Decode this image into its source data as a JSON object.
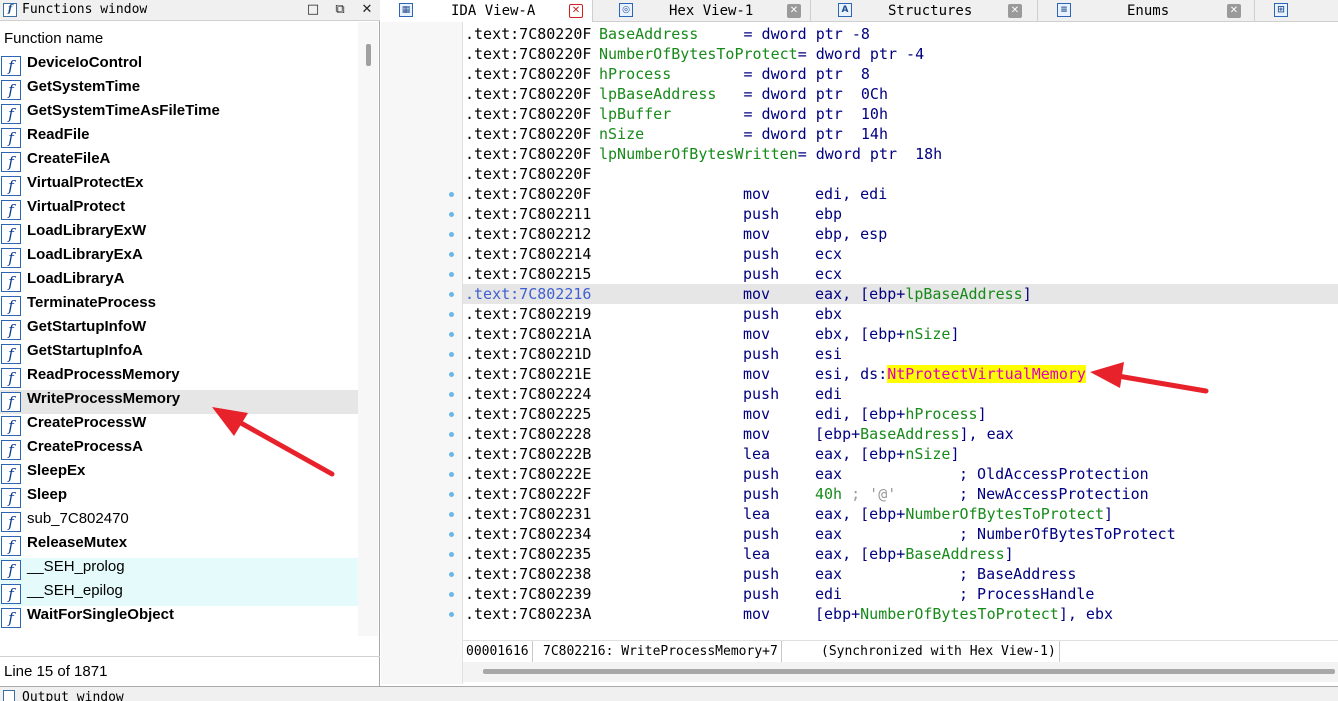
{
  "functions_window": {
    "title": "Functions window",
    "column_header": "Function name",
    "status": "Line 15 of 1871",
    "items": [
      {
        "name": "DeviceIoControl",
        "bold": true,
        "kind": "normal"
      },
      {
        "name": "GetSystemTime",
        "bold": true,
        "kind": "normal"
      },
      {
        "name": "GetSystemTimeAsFileTime",
        "bold": true,
        "kind": "normal"
      },
      {
        "name": "ReadFile",
        "bold": true,
        "kind": "normal"
      },
      {
        "name": "CreateFileA",
        "bold": true,
        "kind": "normal"
      },
      {
        "name": "VirtualProtectEx",
        "bold": true,
        "kind": "normal"
      },
      {
        "name": "VirtualProtect",
        "bold": true,
        "kind": "normal"
      },
      {
        "name": "LoadLibraryExW",
        "bold": true,
        "kind": "normal"
      },
      {
        "name": "LoadLibraryExA",
        "bold": true,
        "kind": "normal"
      },
      {
        "name": "LoadLibraryA",
        "bold": true,
        "kind": "normal"
      },
      {
        "name": "TerminateProcess",
        "bold": true,
        "kind": "normal"
      },
      {
        "name": "GetStartupInfoW",
        "bold": true,
        "kind": "normal"
      },
      {
        "name": "GetStartupInfoA",
        "bold": true,
        "kind": "normal"
      },
      {
        "name": "ReadProcessMemory",
        "bold": true,
        "kind": "normal"
      },
      {
        "name": "WriteProcessMemory",
        "bold": true,
        "kind": "selected"
      },
      {
        "name": "CreateProcessW",
        "bold": true,
        "kind": "normal"
      },
      {
        "name": "CreateProcessA",
        "bold": true,
        "kind": "normal"
      },
      {
        "name": "SleepEx",
        "bold": true,
        "kind": "normal"
      },
      {
        "name": "Sleep",
        "bold": true,
        "kind": "normal"
      },
      {
        "name": "sub_7C802470",
        "bold": false,
        "kind": "normal"
      },
      {
        "name": "ReleaseMutex",
        "bold": true,
        "kind": "normal"
      },
      {
        "name": "__SEH_prolog",
        "bold": false,
        "kind": "lib"
      },
      {
        "name": "__SEH_epilog",
        "bold": false,
        "kind": "lib"
      },
      {
        "name": "WaitForSingleObject",
        "bold": true,
        "kind": "normal"
      }
    ]
  },
  "tabs": [
    {
      "label": "IDA View-A",
      "icon": "graph-view-icon",
      "active": true
    },
    {
      "label": "Hex View-1",
      "icon": "hex-view-icon",
      "active": false
    },
    {
      "label": "Structures",
      "icon": "structures-icon",
      "active": false
    },
    {
      "label": "Enums",
      "icon": "enums-icon",
      "active": false
    }
  ],
  "disasm_lines": [
    {
      "addr": ".text:7C80220F",
      "var": "BaseAddress",
      "pad": "     ",
      "rest": "= dword ptr -8"
    },
    {
      "addr": ".text:7C80220F",
      "var": "NumberOfBytesToProtect",
      "pad": "",
      "rest": "= dword ptr -4"
    },
    {
      "addr": ".text:7C80220F",
      "var": "hProcess",
      "pad": "        ",
      "rest": "= dword ptr  8"
    },
    {
      "addr": ".text:7C80220F",
      "var": "lpBaseAddress",
      "pad": "   ",
      "rest": "= dword ptr  0Ch"
    },
    {
      "addr": ".text:7C80220F",
      "var": "lpBuffer",
      "pad": "        ",
      "rest": "= dword ptr  10h"
    },
    {
      "addr": ".text:7C80220F",
      "var": "nSize",
      "pad": "           ",
      "rest": "= dword ptr  14h"
    },
    {
      "addr": ".text:7C80220F",
      "var": "lpNumberOfBytesWritten",
      "pad": "",
      "rest": "= dword ptr  18h"
    },
    {
      "addr": ".text:7C80220F"
    },
    {
      "addr": ".text:7C80220F",
      "mn": "mov",
      "ops": "edi, edi"
    },
    {
      "addr": ".text:7C802211",
      "mn": "push",
      "ops": "ebp"
    },
    {
      "addr": ".text:7C802212",
      "mn": "mov",
      "ops": "ebp, esp"
    },
    {
      "addr": ".text:7C802214",
      "mn": "push",
      "ops": "ecx"
    },
    {
      "addr": ".text:7C802215",
      "mn": "push",
      "ops": "ecx"
    },
    {
      "addr": ".text:7C802216",
      "mn": "mov",
      "ops_pre": "eax, [ebp+",
      "ops_sym": "lpBaseAddress",
      "ops_post": "]",
      "highlight": true
    },
    {
      "addr": ".text:7C802219",
      "mn": "push",
      "ops": "ebx"
    },
    {
      "addr": ".text:7C80221A",
      "mn": "mov",
      "ops_pre": "ebx, [ebp+",
      "ops_sym": "nSize",
      "ops_post": "]"
    },
    {
      "addr": ".text:7C80221D",
      "mn": "push",
      "ops": "esi"
    },
    {
      "addr": ".text:7C80221E",
      "mn": "mov",
      "ops_pre": "esi, ds:",
      "ops_hl": "NtProtectVirtualMemory"
    },
    {
      "addr": ".text:7C802224",
      "mn": "push",
      "ops": "edi"
    },
    {
      "addr": ".text:7C802225",
      "mn": "mov",
      "ops_pre": "edi, [ebp+",
      "ops_sym": "hProcess",
      "ops_post": "]"
    },
    {
      "addr": ".text:7C802228",
      "mn": "mov",
      "ops_pre": "[ebp+",
      "ops_sym": "BaseAddress",
      "ops_post": "], eax"
    },
    {
      "addr": ".text:7C80222B",
      "mn": "lea",
      "ops_pre": "eax, [ebp+",
      "ops_sym": "nSize",
      "ops_post": "]"
    },
    {
      "addr": ".text:7C80222E",
      "mn": "push",
      "ops": "eax",
      "comment": "; OldAccessProtection"
    },
    {
      "addr": ".text:7C80222F",
      "mn": "push",
      "ops_imm": "40h",
      "ops_cmt": " ; '@'",
      "comment": "; NewAccessProtection"
    },
    {
      "addr": ".text:7C802231",
      "mn": "lea",
      "ops_pre": "eax, [ebp+",
      "ops_sym": "NumberOfBytesToProtect",
      "ops_post": "]"
    },
    {
      "addr": ".text:7C802234",
      "mn": "push",
      "ops": "eax",
      "comment": "; NumberOfBytesToProtect"
    },
    {
      "addr": ".text:7C802235",
      "mn": "lea",
      "ops_pre": "eax, [ebp+",
      "ops_sym": "BaseAddress",
      "ops_post": "]"
    },
    {
      "addr": ".text:7C802238",
      "mn": "push",
      "ops": "eax",
      "comment": "; BaseAddress"
    },
    {
      "addr": ".text:7C802239",
      "mn": "push",
      "ops": "edi",
      "comment": "; ProcessHandle"
    },
    {
      "addr": ".text:7C80223A",
      "mn": "mov",
      "ops_pre": "[ebp+",
      "ops_sym": "NumberOfBytesToProtect",
      "ops_post": "], ebx"
    }
  ],
  "ida_status": {
    "offset": "00001616",
    "location": "7C802216: WriteProcessMemory+7",
    "sync": "(Synchronized with Hex View-1)"
  },
  "output_window": {
    "title": "Output window"
  },
  "colors": {
    "arrow": "#e8222a",
    "symbol_highlight": "#ffff00",
    "symbol_text": "#e000c0",
    "name_green": "#178a1a",
    "code_navy": "#000080"
  }
}
